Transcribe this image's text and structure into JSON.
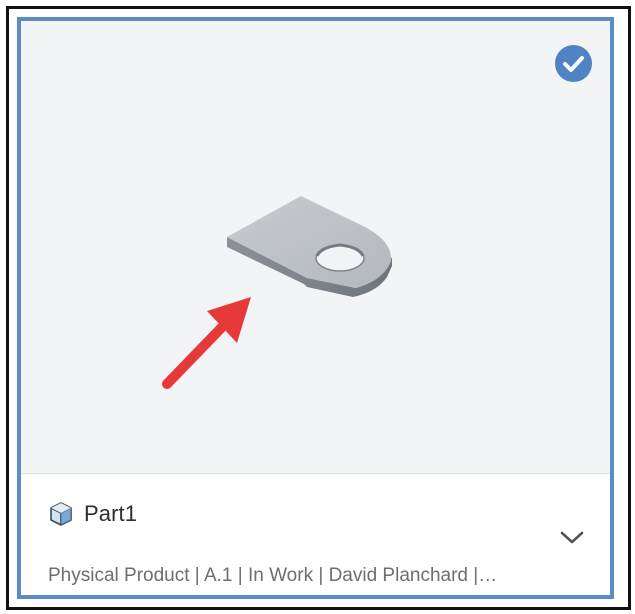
{
  "card": {
    "title": "Part1",
    "meta_line": "Physical Product | A.1 | In Work | David Planchard |…",
    "selected": true,
    "title_icon": "3d-part-cube-icon",
    "selected_icon": "check-circle-icon",
    "expand_icon": "chevron-down-icon",
    "annotation_icon": "red-arrow-icon"
  },
  "colors": {
    "frame_border": "#111111",
    "card_border": "#5b8dc5",
    "thumbnail_background": "#f3f4f6",
    "check_badge": "#4f83c4",
    "arrow": "#e8393a",
    "meta_text": "#6e6e6e"
  }
}
